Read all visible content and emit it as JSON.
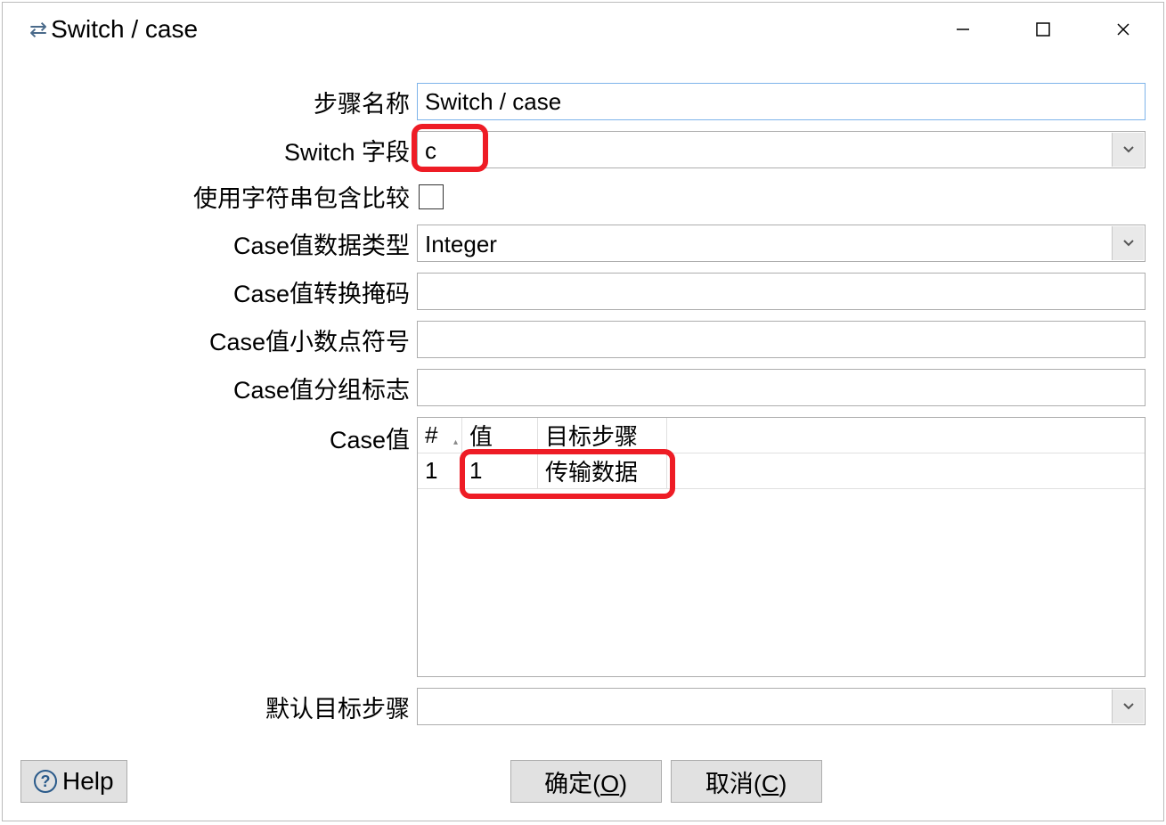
{
  "titlebar": {
    "title": "Switch / case"
  },
  "labels": {
    "step_name": "步骤名称",
    "switch_field": "Switch 字段",
    "use_contains": "使用字符串包含比较",
    "case_type": "Case值数据类型",
    "case_mask": "Case值转换掩码",
    "case_decimal": "Case值小数点符号",
    "case_group": "Case值分组标志",
    "case_values": "Case值",
    "default_target": "默认目标步骤"
  },
  "fields": {
    "step_name": "Switch / case",
    "switch_field": "c",
    "use_contains_checked": false,
    "case_type": "Integer",
    "case_mask": "",
    "case_decimal": "",
    "case_group": "",
    "default_target": ""
  },
  "table": {
    "headers": {
      "idx": "#",
      "value": "值",
      "target": "目标步骤"
    },
    "rows": [
      {
        "idx": "1",
        "value": "1",
        "target": "传输数据"
      }
    ]
  },
  "buttons": {
    "help": "Help",
    "ok_prefix": "确定(",
    "ok_key": "O",
    "ok_suffix": ")",
    "cancel_prefix": "取消(",
    "cancel_key": "C",
    "cancel_suffix": ")"
  }
}
